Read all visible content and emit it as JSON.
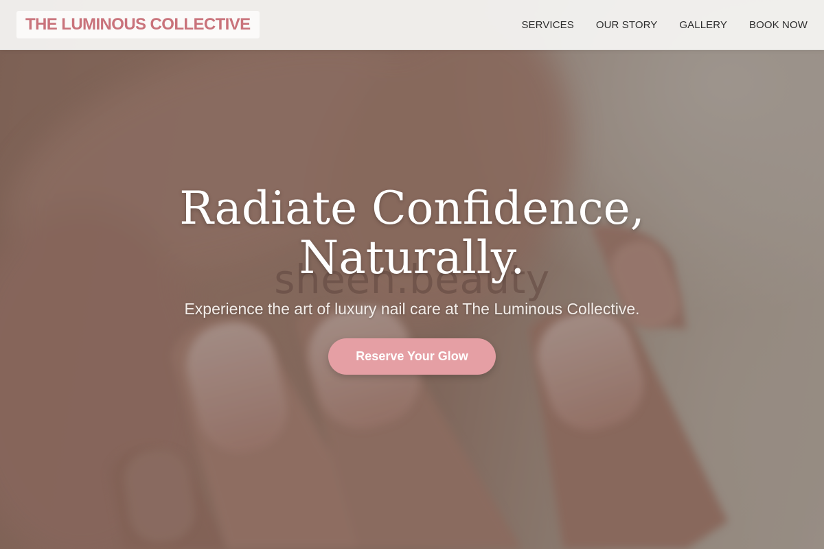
{
  "header": {
    "logo": "THE LUMINOUS COLLECTIVE",
    "nav": [
      {
        "label": "SERVICES"
      },
      {
        "label": "OUR STORY"
      },
      {
        "label": "GALLERY"
      },
      {
        "label": "BOOK NOW"
      }
    ]
  },
  "hero": {
    "title_line1": "Radiate Confidence,",
    "title_line2": "Naturally.",
    "subtitle": "Experience the art of luxury nail care at The Luminous Collective.",
    "cta_label": "Reserve Your Glow",
    "watermark": "sheen.beauty",
    "background_image": "manicured-hand-photo"
  },
  "colors": {
    "brand": "#c9737b",
    "cta": "#e59fa4",
    "header_bg": "#f4f2f0",
    "nav_text": "#2c2c2c"
  }
}
